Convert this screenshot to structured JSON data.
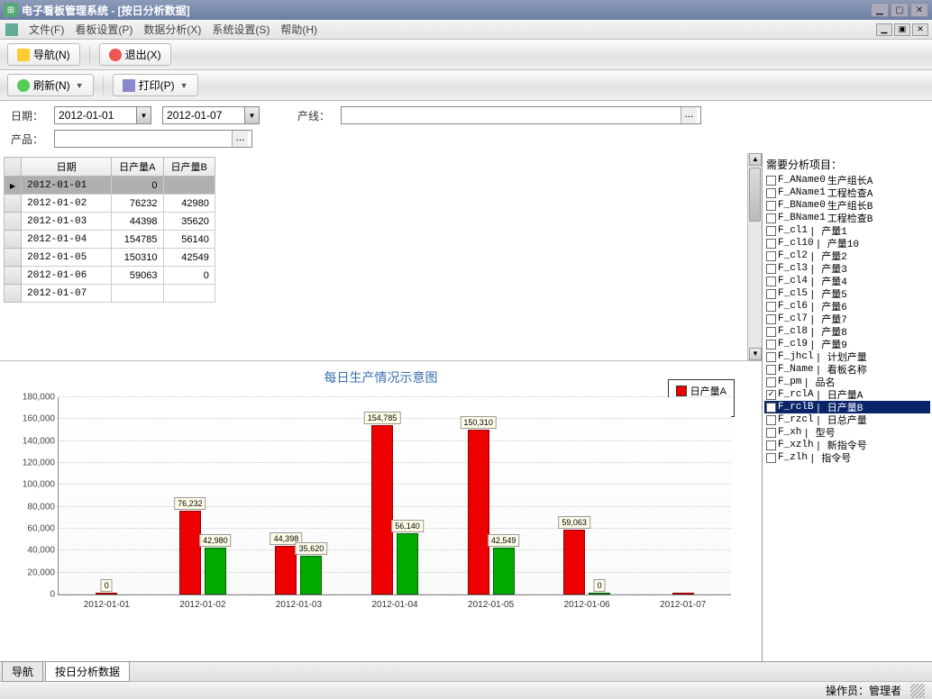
{
  "title": "电子看板管理系统 - [按日分析数据]",
  "menus": [
    "文件(F)",
    "看板设置(P)",
    "数据分析(X)",
    "系统设置(S)",
    "帮助(H)"
  ],
  "toolbar1": {
    "nav": "导航(N)",
    "exit": "退出(X)"
  },
  "toolbar2": {
    "refresh": "刷新(N)",
    "print": "打印(P)"
  },
  "filters": {
    "date_label": "日期：",
    "date_from": "2012-01-01",
    "date_to": "2012-01-07",
    "line_label": "产线：",
    "line_value": "",
    "product_label": "产品：",
    "product_value": ""
  },
  "grid": {
    "headers": [
      "日期",
      "日产量A",
      "日产量B"
    ],
    "rows": [
      {
        "date": "2012-01-01",
        "a": "0",
        "b": "",
        "sel": true
      },
      {
        "date": "2012-01-02",
        "a": "76232",
        "b": "42980"
      },
      {
        "date": "2012-01-03",
        "a": "44398",
        "b": "35620"
      },
      {
        "date": "2012-01-04",
        "a": "154785",
        "b": "56140"
      },
      {
        "date": "2012-01-05",
        "a": "150310",
        "b": "42549"
      },
      {
        "date": "2012-01-06",
        "a": "59063",
        "b": "0"
      },
      {
        "date": "2012-01-07",
        "a": "",
        "b": ""
      }
    ]
  },
  "chart_data": {
    "type": "bar",
    "title": "每日生产情况示意图",
    "categories": [
      "2012-01-01",
      "2012-01-02",
      "2012-01-03",
      "2012-01-04",
      "2012-01-05",
      "2012-01-06",
      "2012-01-07"
    ],
    "series": [
      {
        "name": "日产量A",
        "color": "#e00",
        "values": [
          0,
          76232,
          44398,
          154785,
          150310,
          59063,
          0
        ]
      },
      {
        "name": "日产量B",
        "color": "#0a0",
        "values": [
          null,
          42980,
          35620,
          56140,
          42549,
          0,
          null
        ]
      }
    ],
    "ylim": [
      0,
      180000
    ],
    "yticks": [
      0,
      20000,
      40000,
      60000,
      80000,
      100000,
      120000,
      140000,
      160000,
      180000
    ],
    "labels": {
      "0": [
        "0"
      ],
      "1": [
        "76,232",
        "42,980"
      ],
      "2": [
        "44,398",
        "35,620"
      ],
      "3": [
        "154,785",
        "56,140"
      ],
      "4": [
        "150,310",
        "42,549"
      ],
      "5": [
        "59,063",
        "0"
      ]
    }
  },
  "right_panel": {
    "header": "需要分析项目：",
    "items": [
      {
        "code": "F_AName0",
        "label": "生产组长A",
        "checked": false
      },
      {
        "code": "F_AName1",
        "label": "工程检查A",
        "checked": false
      },
      {
        "code": "F_BName0",
        "label": "生产组长B",
        "checked": false
      },
      {
        "code": "F_BName1",
        "label": "工程检查B",
        "checked": false
      },
      {
        "code": "F_cl1",
        "label": "| 产量1",
        "checked": false
      },
      {
        "code": "F_cl10",
        "label": "| 产量10",
        "checked": false
      },
      {
        "code": "F_cl2",
        "label": "| 产量2",
        "checked": false
      },
      {
        "code": "F_cl3",
        "label": "| 产量3",
        "checked": false
      },
      {
        "code": "F_cl4",
        "label": "| 产量4",
        "checked": false
      },
      {
        "code": "F_cl5",
        "label": "| 产量5",
        "checked": false
      },
      {
        "code": "F_cl6",
        "label": "| 产量6",
        "checked": false
      },
      {
        "code": "F_cl7",
        "label": "| 产量7",
        "checked": false
      },
      {
        "code": "F_cl8",
        "label": "| 产量8",
        "checked": false
      },
      {
        "code": "F_cl9",
        "label": "| 产量9",
        "checked": false
      },
      {
        "code": "F_jhcl",
        "label": "| 计划产量",
        "checked": false
      },
      {
        "code": "F_Name",
        "label": "| 看板名称",
        "checked": false
      },
      {
        "code": "F_pm",
        "label": "| 品名",
        "checked": false
      },
      {
        "code": "F_rclA",
        "label": "| 日产量A",
        "checked": true
      },
      {
        "code": "F_rclB",
        "label": "| 日产量B",
        "checked": true,
        "sel": true
      },
      {
        "code": "F_rzcl",
        "label": "| 日总产量",
        "checked": false
      },
      {
        "code": "F_xh",
        "label": "| 型号",
        "checked": false
      },
      {
        "code": "F_xzlh",
        "label": "| 新指令号",
        "checked": false
      },
      {
        "code": "F_zlh",
        "label": "| 指令号",
        "checked": false
      }
    ]
  },
  "bottom_tabs": [
    "导航",
    "按日分析数据"
  ],
  "status": {
    "operator_label": "操作员：",
    "operator": "管理者"
  }
}
